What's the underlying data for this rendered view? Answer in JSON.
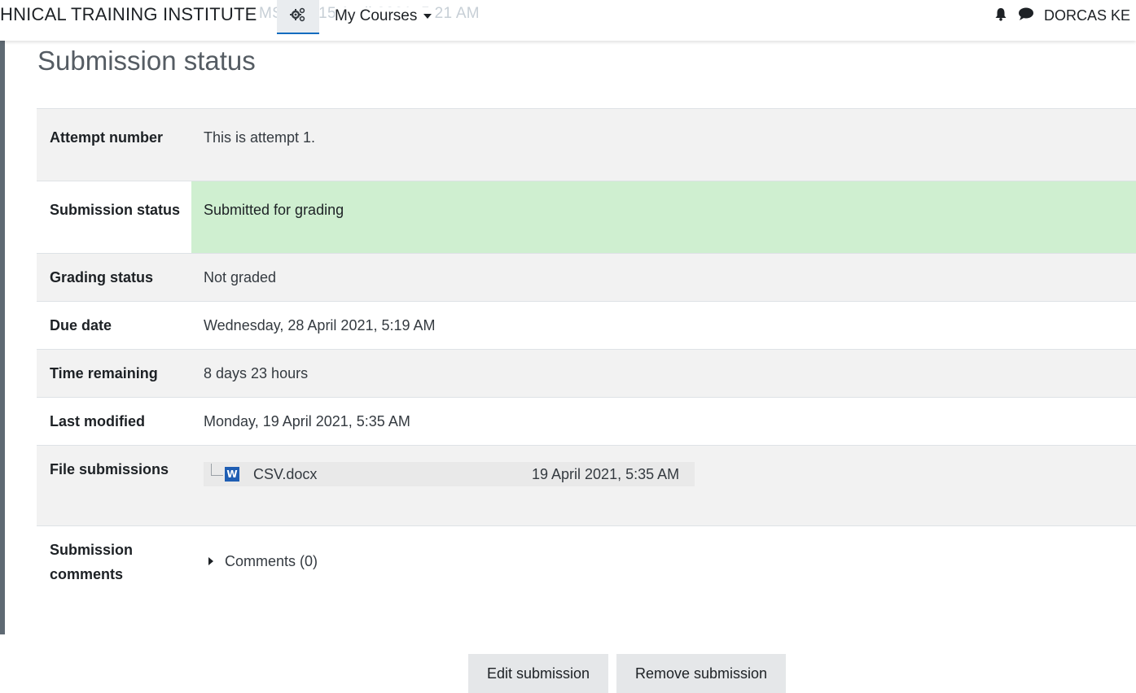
{
  "navbar": {
    "brand": "HNICAL TRAINING INSTITUTE",
    "ghost_text": "MS        n       1.   15 April 2021, 5:21 AM",
    "mycourses_label": "My Courses",
    "username": "DORCAS KE"
  },
  "page": {
    "title": "Submission status"
  },
  "rows": [
    {
      "label": "Attempt number",
      "value": "This is attempt 1."
    },
    {
      "label": "Submission status",
      "value": "Submitted for grading"
    },
    {
      "label": "Grading status",
      "value": "Not graded"
    },
    {
      "label": "Due date",
      "value": "Wednesday, 28 April 2021, 5:19 AM"
    },
    {
      "label": "Time remaining",
      "value": "8 days 23 hours"
    },
    {
      "label": "Last modified",
      "value": "Monday, 19 April 2021, 5:35 AM"
    },
    {
      "label": "File submissions"
    },
    {
      "label": "Submission comments"
    }
  ],
  "file": {
    "icon_letter": "W",
    "name": "CSV.docx",
    "date": "19 April 2021, 5:35 AM"
  },
  "comments": {
    "label": "Comments (0)"
  },
  "buttons": {
    "edit": "Edit submission",
    "remove": "Remove submission"
  },
  "colors": {
    "submitted_bg": "#cfefd0",
    "accent": "#0f6cbf",
    "word_blue": "#1f5eb3"
  },
  "icons": [
    "gears-icon",
    "caret-down-icon",
    "bell-icon",
    "chat-bubble-icon",
    "word-doc-icon",
    "caret-right-icon"
  ]
}
